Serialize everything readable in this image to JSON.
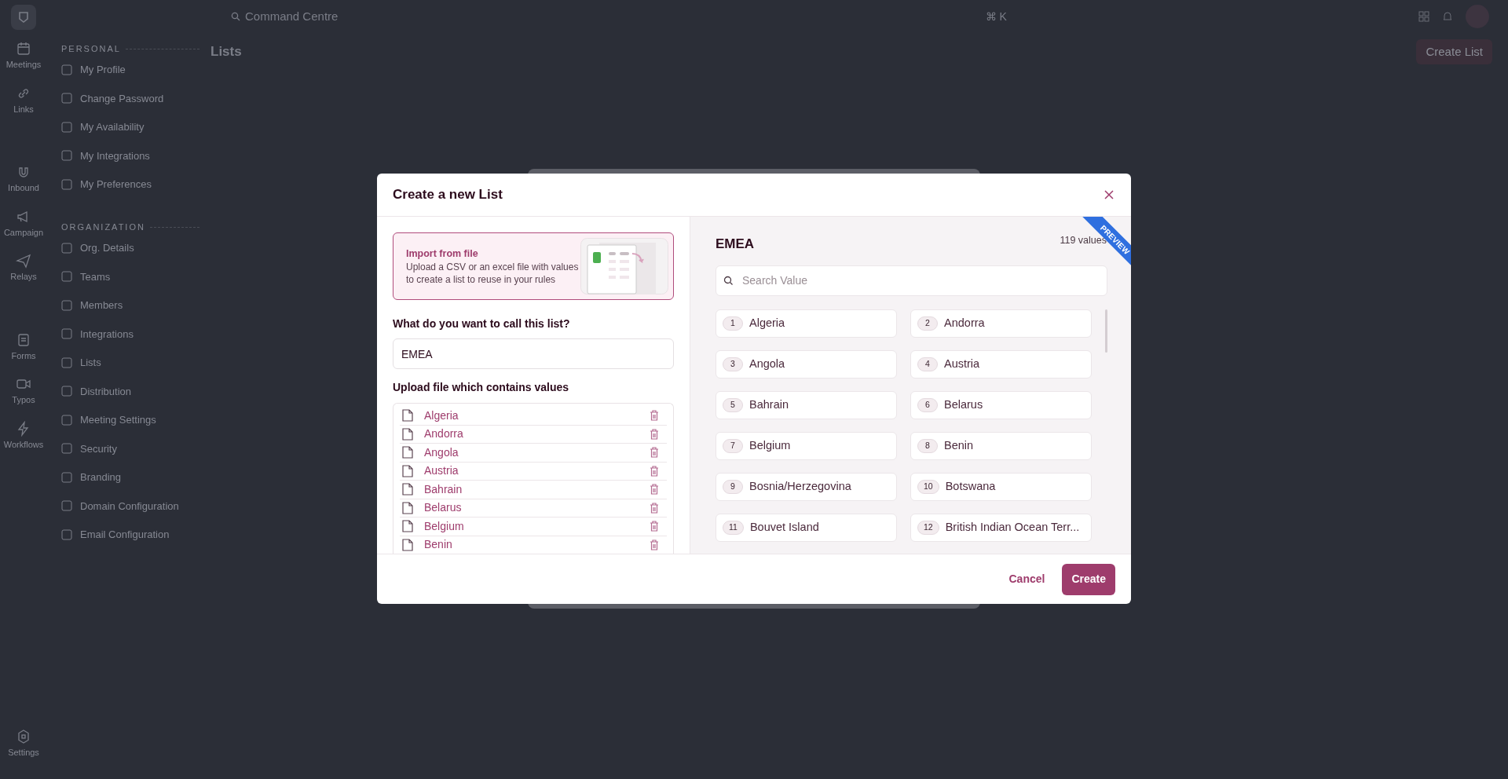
{
  "topbar": {
    "search_label": "Command Centre",
    "shortcut": "⌘ K"
  },
  "rail": [
    {
      "label": "Meetings"
    },
    {
      "label": "Links"
    },
    {
      "label": "Inbound"
    },
    {
      "label": "Campaign"
    },
    {
      "label": "Relays"
    },
    {
      "label": "Forms"
    },
    {
      "label": "Typos"
    },
    {
      "label": "Workflows"
    }
  ],
  "rail_footer": {
    "label": "Settings"
  },
  "settings_nav": [
    {
      "heading": "PERSONAL",
      "items": [
        "My Profile",
        "Change Password",
        "My Availability",
        "My Integrations",
        "My Preferences"
      ]
    },
    {
      "heading": "ORGANIZATION",
      "items": [
        "Org. Details",
        "Teams",
        "Members",
        "Integrations",
        "Lists",
        "Distribution",
        "Meeting Settings",
        "Security",
        "Branding",
        "Domain Configuration",
        "Email Configuration"
      ]
    }
  ],
  "page": {
    "title": "Lists",
    "create_button": "Create List"
  },
  "modal": {
    "title": "Create a new List",
    "import_card": {
      "title": "Import from file",
      "description": "Upload a CSV or an excel file with values to create a list to reuse in your rules"
    },
    "name_label": "What do you want to call this list?",
    "name_value": "EMEA",
    "upload_label": "Upload file which contains values",
    "files": [
      "Algeria",
      "Andorra",
      "Angola",
      "Austria",
      "Bahrain",
      "Belarus",
      "Belgium",
      "Benin"
    ],
    "preview": {
      "ribbon": "PREVIEW",
      "title": "EMEA",
      "count": "119 values",
      "search_placeholder": "Search Value",
      "values": [
        {
          "index": "1",
          "label": "Algeria"
        },
        {
          "index": "2",
          "label": "Andorra"
        },
        {
          "index": "3",
          "label": "Angola"
        },
        {
          "index": "4",
          "label": "Austria"
        },
        {
          "index": "5",
          "label": "Bahrain"
        },
        {
          "index": "6",
          "label": "Belarus"
        },
        {
          "index": "7",
          "label": "Belgium"
        },
        {
          "index": "8",
          "label": "Benin"
        },
        {
          "index": "9",
          "label": "Bosnia/Herzegovina"
        },
        {
          "index": "10",
          "label": "Botswana"
        },
        {
          "index": "11",
          "label": "Bouvet Island"
        },
        {
          "index": "12",
          "label": "British Indian Ocean Terr..."
        }
      ]
    },
    "cancel": "Cancel",
    "create": "Create"
  }
}
